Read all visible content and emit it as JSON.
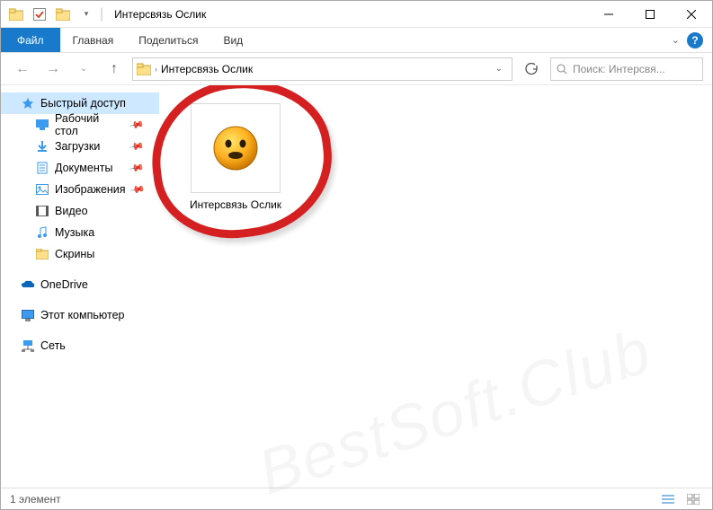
{
  "window_title": "Интерсвязь Ослик",
  "ribbon": {
    "file": "Файл",
    "tabs": [
      "Главная",
      "Поделиться",
      "Вид"
    ]
  },
  "breadcrumb": {
    "segments": [
      "Интерсвязь Ослик"
    ]
  },
  "search": {
    "placeholder": "Поиск: Интерсвя..."
  },
  "sidebar": {
    "quick_access": "Быстрый доступ",
    "items": [
      {
        "label": "Рабочий стол",
        "pinned": true
      },
      {
        "label": "Загрузки",
        "pinned": true
      },
      {
        "label": "Документы",
        "pinned": true
      },
      {
        "label": "Изображения",
        "pinned": true
      },
      {
        "label": "Видео",
        "pinned": false
      },
      {
        "label": "Музыка",
        "pinned": false
      },
      {
        "label": "Скрины",
        "pinned": false
      }
    ],
    "onedrive": "OneDrive",
    "this_pc": "Этот компьютер",
    "network": "Сеть"
  },
  "content": {
    "file_name": "Интерсвязь Ослик"
  },
  "status": {
    "text": "1 элемент"
  },
  "watermark": "BestSoft.Club"
}
